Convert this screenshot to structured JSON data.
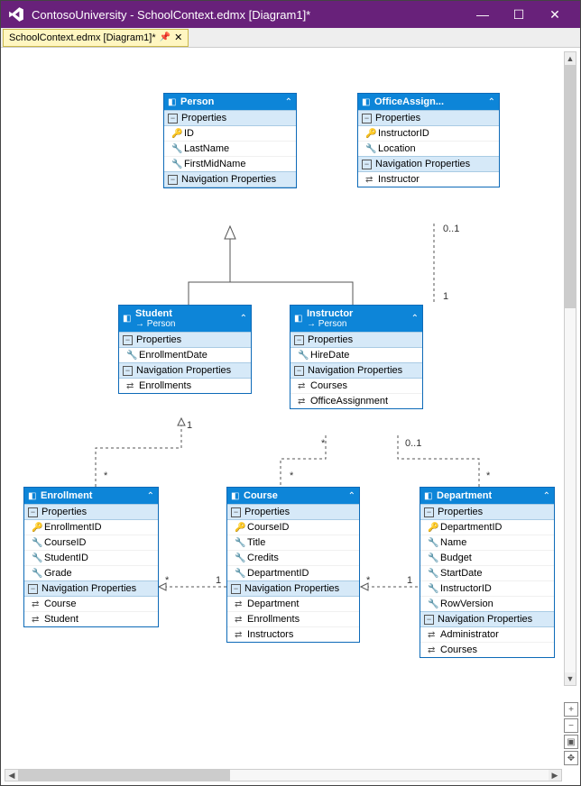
{
  "window": {
    "app_title": "ContosoUniversity - SchoolContext.edmx [Diagram1]*"
  },
  "tab": {
    "label": "SchoolContext.edmx [Diagram1]*"
  },
  "entities": {
    "person": {
      "title": "Person",
      "props_header": "Properties",
      "nav_header": "Navigation Properties",
      "props": [
        {
          "icon": "key",
          "name": "ID"
        },
        {
          "icon": "wrench",
          "name": "LastName"
        },
        {
          "icon": "wrench",
          "name": "FirstMidName"
        }
      ],
      "navs": []
    },
    "office": {
      "title": "OfficeAssign...",
      "props_header": "Properties",
      "nav_header": "Navigation Properties",
      "props": [
        {
          "icon": "key",
          "name": "InstructorID"
        },
        {
          "icon": "wrench",
          "name": "Location"
        }
      ],
      "navs": [
        {
          "icon": "nav",
          "name": "Instructor"
        }
      ]
    },
    "student": {
      "title": "Student",
      "base": "Person",
      "props_header": "Properties",
      "nav_header": "Navigation Properties",
      "props": [
        {
          "icon": "wrench",
          "name": "EnrollmentDate"
        }
      ],
      "navs": [
        {
          "icon": "nav",
          "name": "Enrollments"
        }
      ]
    },
    "instructor": {
      "title": "Instructor",
      "base": "Person",
      "props_header": "Properties",
      "nav_header": "Navigation Properties",
      "props": [
        {
          "icon": "wrench",
          "name": "HireDate"
        }
      ],
      "navs": [
        {
          "icon": "nav",
          "name": "Courses"
        },
        {
          "icon": "nav",
          "name": "OfficeAssignment"
        }
      ]
    },
    "enrollment": {
      "title": "Enrollment",
      "props_header": "Properties",
      "nav_header": "Navigation Properties",
      "props": [
        {
          "icon": "key",
          "name": "EnrollmentID"
        },
        {
          "icon": "wrench",
          "name": "CourseID"
        },
        {
          "icon": "wrench",
          "name": "StudentID"
        },
        {
          "icon": "wrench",
          "name": "Grade"
        }
      ],
      "navs": [
        {
          "icon": "nav",
          "name": "Course"
        },
        {
          "icon": "nav",
          "name": "Student"
        }
      ]
    },
    "course": {
      "title": "Course",
      "props_header": "Properties",
      "nav_header": "Navigation Properties",
      "props": [
        {
          "icon": "key",
          "name": "CourseID"
        },
        {
          "icon": "wrench",
          "name": "Title"
        },
        {
          "icon": "wrench",
          "name": "Credits"
        },
        {
          "icon": "wrench",
          "name": "DepartmentID"
        }
      ],
      "navs": [
        {
          "icon": "nav",
          "name": "Department"
        },
        {
          "icon": "nav",
          "name": "Enrollments"
        },
        {
          "icon": "nav",
          "name": "Instructors"
        }
      ]
    },
    "department": {
      "title": "Department",
      "props_header": "Properties",
      "nav_header": "Navigation Properties",
      "props": [
        {
          "icon": "key",
          "name": "DepartmentID"
        },
        {
          "icon": "wrench",
          "name": "Name"
        },
        {
          "icon": "wrench",
          "name": "Budget"
        },
        {
          "icon": "wrench",
          "name": "StartDate"
        },
        {
          "icon": "wrench",
          "name": "InstructorID"
        },
        {
          "icon": "wrench",
          "name": "RowVersion"
        }
      ],
      "navs": [
        {
          "icon": "nav",
          "name": "Administrator"
        },
        {
          "icon": "nav",
          "name": "Courses"
        }
      ]
    }
  },
  "multiplicity": {
    "zero_one": "0..1",
    "one": "1",
    "star": "*"
  }
}
